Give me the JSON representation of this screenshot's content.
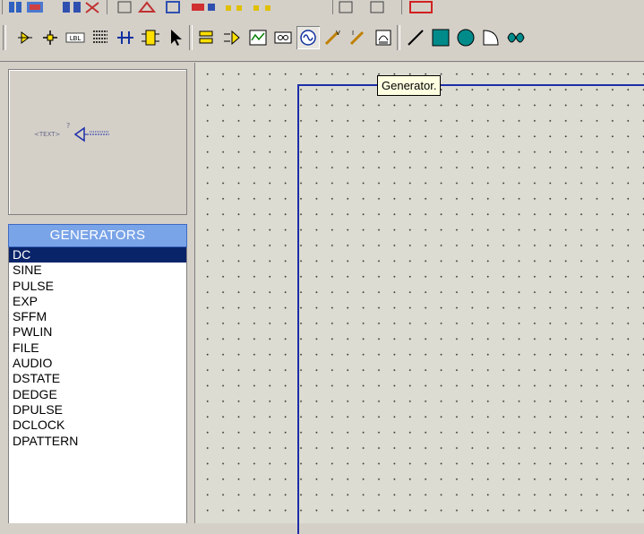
{
  "tooltip": {
    "text": "Generator."
  },
  "preview": {
    "text_placeholder": "<TEXT>",
    "question_mark": "?"
  },
  "generators": {
    "header": "GENERATORS",
    "items": [
      "DC",
      "SINE",
      "PULSE",
      "EXP",
      "SFFM",
      "PWLIN",
      "FILE",
      "AUDIO",
      "DSTATE",
      "DEDGE",
      "DPULSE",
      "DCLOCK",
      "DPATTERN"
    ],
    "selected": "DC"
  },
  "toolbar": {
    "main_icons": [
      "component-mode-icon",
      "junction-dot-icon",
      "wire-label-icon",
      "script-icon",
      "bus-icon",
      "sub-circuit-icon",
      "selection-icon",
      "terminals-icon",
      "device-pins-icon",
      "graph-icon",
      "tape-recorder-icon",
      "generator-icon",
      "voltage-probe-icon",
      "current-probe-icon",
      "virtual-instruments-icon",
      "line-icon",
      "box-icon",
      "circle-icon",
      "arc-icon",
      "path-icon"
    ],
    "active_tool": "generator-icon"
  },
  "colors": {
    "sheet_border": "#1c2ea8",
    "list_selected": "#0a246a",
    "list_header": "#7aa4e8",
    "tooltip_bg": "#ffffe1"
  }
}
